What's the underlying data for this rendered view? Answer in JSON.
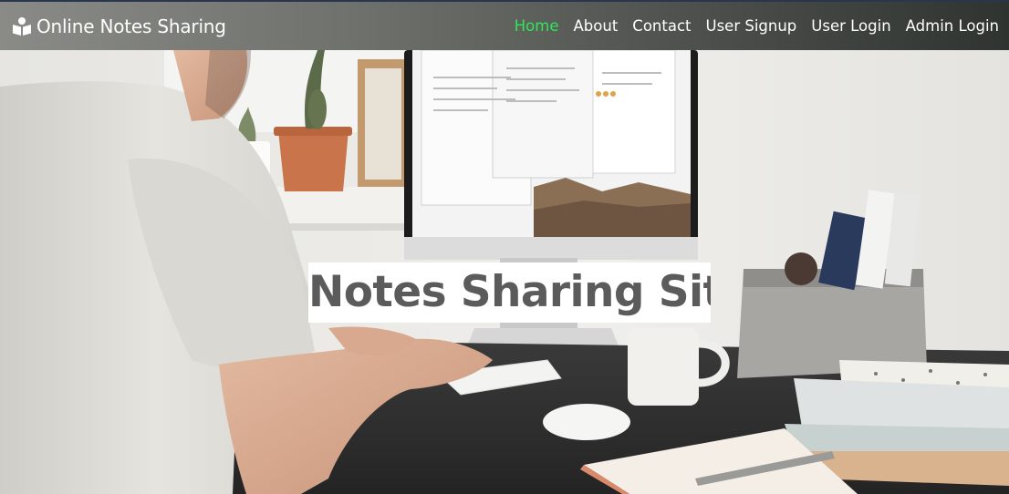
{
  "app": {
    "brand": "Online Notes Sharing",
    "brand_icon": "reader-icon"
  },
  "nav": {
    "items": [
      {
        "label": "Home",
        "active": true
      },
      {
        "label": "About",
        "active": false
      },
      {
        "label": "Contact",
        "active": false
      },
      {
        "label": "User Signup",
        "active": false
      },
      {
        "label": "User Login",
        "active": false
      },
      {
        "label": "Admin Login",
        "active": false
      }
    ],
    "active_color": "#2ee65a"
  },
  "hero": {
    "title": "Notes Sharing Site",
    "background": "photo of a man working at a desktop computer"
  }
}
